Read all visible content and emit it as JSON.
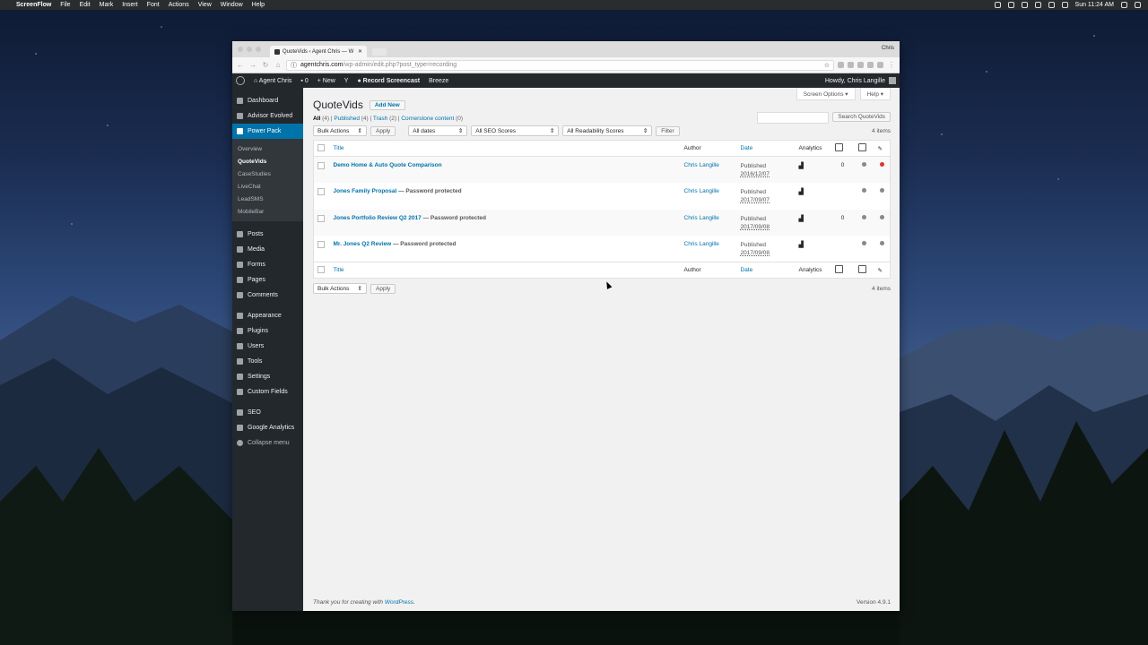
{
  "mac_menubar": {
    "app": "ScreenFlow",
    "items": [
      "File",
      "Edit",
      "Mark",
      "Insert",
      "Font",
      "Actions",
      "View",
      "Window",
      "Help"
    ],
    "clock": "Sun 11:24 AM"
  },
  "browser": {
    "tab_title": "QuoteVids ‹ Agent Chris — W",
    "profile": "Chris",
    "url_host": "agentchris.com",
    "url_path": "/wp-admin/edit.php?post_type=recording"
  },
  "adminbar": {
    "site": "Agent Chris",
    "comments": "0",
    "new": "New",
    "record": "Record Screencast",
    "breeze": "Breeze",
    "howdy": "Howdy, Chris Langille"
  },
  "sidebar": {
    "top": [
      {
        "label": "Dashboard",
        "icon": "dashboard-icon"
      },
      {
        "label": "Advisor Evolved",
        "icon": "advisor-icon"
      },
      {
        "label": "Power Pack",
        "icon": "lightning-icon",
        "active": true
      }
    ],
    "sub": [
      "Overview",
      "QuoteVids",
      "CaseStudies",
      "LiveChat",
      "LeadSMS",
      "MobileBar"
    ],
    "group1": [
      {
        "label": "Posts",
        "icon": "pin-icon"
      },
      {
        "label": "Media",
        "icon": "media-icon"
      },
      {
        "label": "Forms",
        "icon": "forms-icon"
      },
      {
        "label": "Pages",
        "icon": "pages-icon"
      },
      {
        "label": "Comments",
        "icon": "comments-icon"
      }
    ],
    "group2": [
      {
        "label": "Appearance",
        "icon": "brush-icon"
      },
      {
        "label": "Plugins",
        "icon": "plugin-icon"
      },
      {
        "label": "Users",
        "icon": "users-icon"
      },
      {
        "label": "Tools",
        "icon": "wrench-icon"
      },
      {
        "label": "Settings",
        "icon": "settings-icon"
      },
      {
        "label": "Custom Fields",
        "icon": "fields-icon"
      }
    ],
    "group3": [
      {
        "label": "SEO",
        "icon": "seo-icon"
      },
      {
        "label": "Google Analytics",
        "icon": "analytics-icon"
      }
    ],
    "collapse": "Collapse menu"
  },
  "page": {
    "screen_options": "Screen Options ▾",
    "help": "Help ▾",
    "title": "QuoteVids",
    "add_new": "Add New",
    "views": {
      "all": "All",
      "all_count": "(4)",
      "published": "Published",
      "published_count": "(4)",
      "trash": "Trash",
      "trash_count": "(2)",
      "cornerstone": "Cornerstone content",
      "cornerstone_count": "(0)"
    },
    "search_button": "Search QuoteVids",
    "bulk_actions": "Bulk Actions",
    "apply": "Apply",
    "all_dates": "All dates",
    "seo_scores": "All SEO Scores",
    "readability": "All Readability Scores",
    "filter": "Filter",
    "items_count": "4 items",
    "columns": {
      "title": "Title",
      "author": "Author",
      "date": "Date",
      "analytics": "Analytics"
    },
    "rows": [
      {
        "title": "Demo Home & Auto Quote Comparison",
        "suffix": "",
        "author": "Chris Langille",
        "status": "Published",
        "date": "2016/12/07",
        "count": "0",
        "dot": "red"
      },
      {
        "title": "Jones Family Proposal",
        "suffix": " — Password protected",
        "author": "Chris Langille",
        "status": "Published",
        "date": "2017/09/07",
        "count": "",
        "dot": "grey"
      },
      {
        "title": "Jones Portfolio Review Q2 2017",
        "suffix": " — Password protected",
        "author": "Chris Langille",
        "status": "Published",
        "date": "2017/09/08",
        "count": "0",
        "dot": "grey"
      },
      {
        "title": "Mr. Jones Q2 Review",
        "suffix": " — Password protected",
        "author": "Chris Langille",
        "status": "Published",
        "date": "2017/09/08",
        "count": "",
        "dot": "grey"
      }
    ],
    "footer_thanks": "Thank you for creating with",
    "footer_link": "WordPress",
    "version": "Version 4.9.1"
  }
}
